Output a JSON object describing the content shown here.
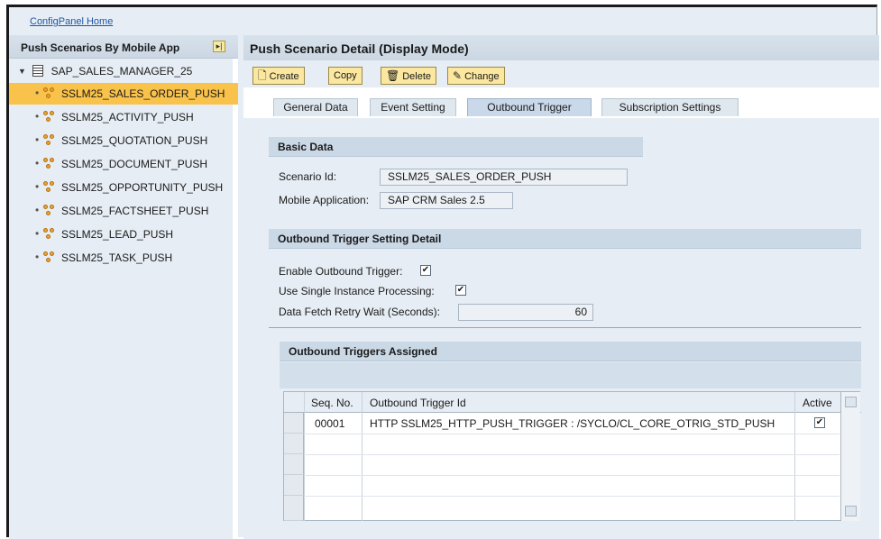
{
  "top": {
    "home_link": "ConfigPanel Home"
  },
  "left": {
    "title": "Push Scenarios By Mobile App",
    "collapse_icon": "collapse-panel-icon",
    "root": "SAP_SALES_MANAGER_25",
    "items": [
      {
        "label": "SSLM25_SALES_ORDER_PUSH",
        "selected": true
      },
      {
        "label": "SSLM25_ACTIVITY_PUSH"
      },
      {
        "label": "SSLM25_QUOTATION_PUSH"
      },
      {
        "label": "SSLM25_DOCUMENT_PUSH"
      },
      {
        "label": "SSLM25_OPPORTUNITY_PUSH"
      },
      {
        "label": "SSLM25_FACTSHEET_PUSH"
      },
      {
        "label": "SSLM25_LEAD_PUSH"
      },
      {
        "label": "SSLM25_TASK_PUSH"
      }
    ]
  },
  "main": {
    "title": "Push Scenario Detail (Display Mode)",
    "toolbar": {
      "create": "Create",
      "copy": "Copy",
      "delete": "Delete",
      "change": "Change"
    },
    "tabs": [
      {
        "label": "General Data"
      },
      {
        "label": "Event Setting"
      },
      {
        "label": "Outbound Trigger",
        "active": true
      },
      {
        "label": "Subscription Settings"
      }
    ],
    "basic": {
      "title": "Basic Data",
      "scenario_label": "Scenario Id:",
      "scenario_value": "SSLM25_SALES_ORDER_PUSH",
      "app_label": "Mobile Application:",
      "app_value": "SAP CRM Sales 2.5"
    },
    "trigger_detail": {
      "title": "Outbound Trigger Setting Detail",
      "enable_label": "Enable Outbound Trigger:",
      "enable_checked": true,
      "single_label": "Use Single Instance Processing:",
      "single_checked": true,
      "retry_label": "Data Fetch Retry Wait (Seconds):",
      "retry_value": "60"
    },
    "assigned": {
      "title": "Outbound Triggers Assigned",
      "columns": {
        "seq": "Seq. No.",
        "trigger": "Outbound Trigger Id",
        "active": "Active"
      },
      "rows": [
        {
          "seq": "00001",
          "trigger": "HTTP SSLM25_HTTP_PUSH_TRIGGER : /SYCLO/CL_CORE_OTRIG_STD_PUSH",
          "active": true
        }
      ]
    }
  },
  "colors": {
    "selected_row": "#f9c24a",
    "panel_bg": "#e6edf4",
    "button_bg": "#fbe7a0",
    "link": "#1f57a6"
  }
}
